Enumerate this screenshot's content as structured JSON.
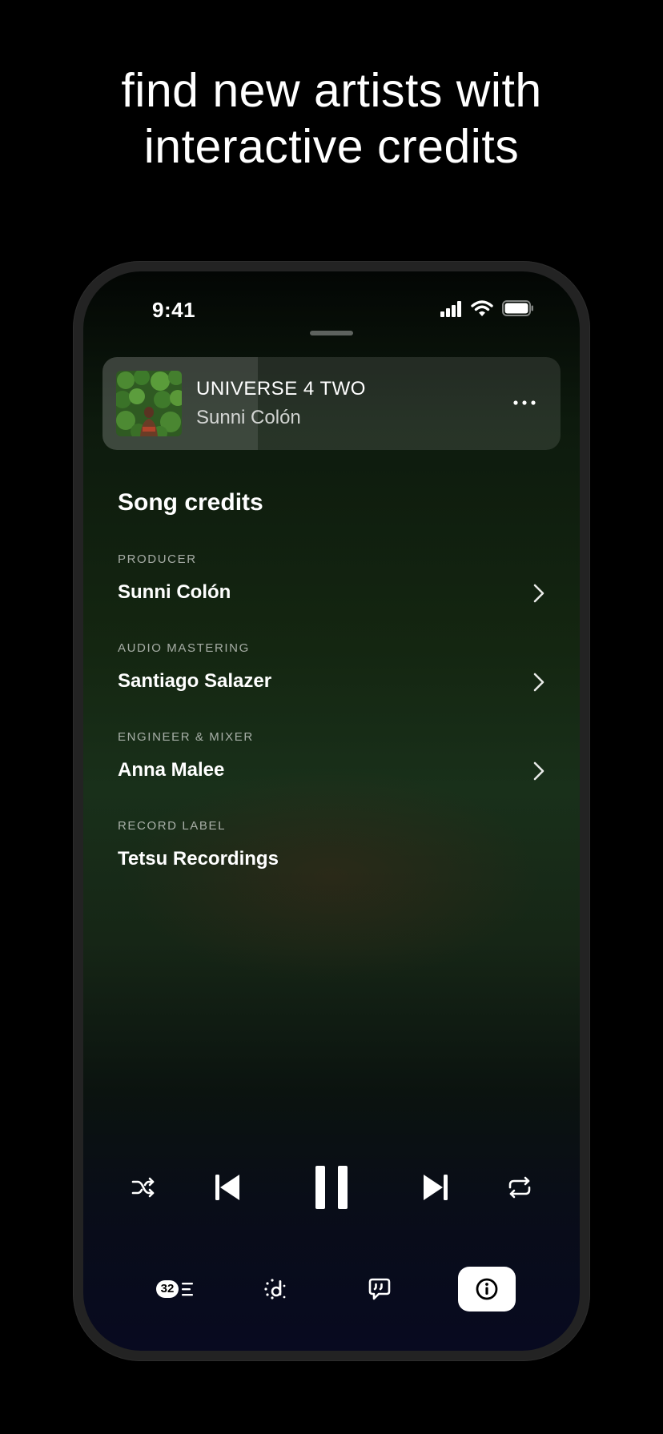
{
  "headline": {
    "line1": "find new artists with",
    "line2": "interactive credits"
  },
  "status_bar": {
    "time": "9:41",
    "signal_icon": "cellular-signal-icon",
    "wifi_icon": "wifi-icon",
    "battery_icon": "battery-full-icon"
  },
  "now_playing": {
    "title": "UNIVERSE 4 TWO",
    "artist": "Sunni Colón",
    "progress_fraction": 0.34,
    "more_icon": "more-horizontal-icon"
  },
  "credits": {
    "section_title": "Song credits",
    "items": [
      {
        "role": "PRODUCER",
        "name": "Sunni Colón",
        "has_link": true
      },
      {
        "role": "AUDIO MASTERING",
        "name": "Santiago Salazer",
        "has_link": true
      },
      {
        "role": "ENGINEER & MIXER",
        "name": "Anna Malee",
        "has_link": true
      },
      {
        "role": "RECORD LABEL",
        "name": "Tetsu Recordings",
        "has_link": false
      }
    ]
  },
  "controls": {
    "shuffle_icon": "shuffle-icon",
    "previous_icon": "skip-back-icon",
    "pause_icon": "pause-icon",
    "next_icon": "skip-forward-icon",
    "repeat_icon": "repeat-icon"
  },
  "tabs": {
    "queue_count": "32",
    "items": [
      "queue-icon",
      "discover-icon",
      "lyrics-icon",
      "info-icon"
    ],
    "active": "info"
  },
  "colors": {
    "background": "#000000",
    "accent_green": "#19301a",
    "accent_navy": "#080a20"
  }
}
